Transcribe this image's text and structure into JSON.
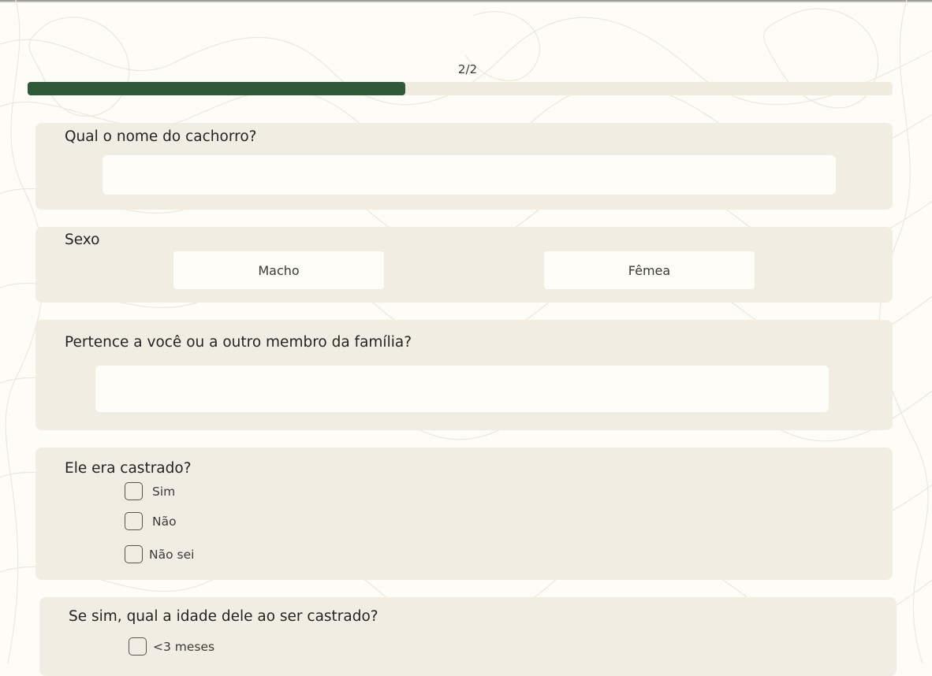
{
  "progress": {
    "label": "2/2",
    "fraction": 0.437
  },
  "questions": {
    "dog_name": {
      "label": "Qual o nome do cachorro?",
      "value": ""
    },
    "sex": {
      "label": "Sexo",
      "options": [
        "Macho",
        "Fêmea"
      ]
    },
    "owner": {
      "label": "Pertence a você ou a outro membro da família?",
      "value": ""
    },
    "neutered": {
      "label": "Ele era castrado?",
      "options": [
        "Sim",
        "Não",
        "Não sei"
      ]
    },
    "neuter_age": {
      "label": "Se sim, qual a idade dele ao ser castrado?",
      "options": [
        "<3 meses"
      ]
    }
  },
  "colors": {
    "accent": "#2f5a38",
    "card": "#f1ede2",
    "background": "#fdfcf6"
  }
}
